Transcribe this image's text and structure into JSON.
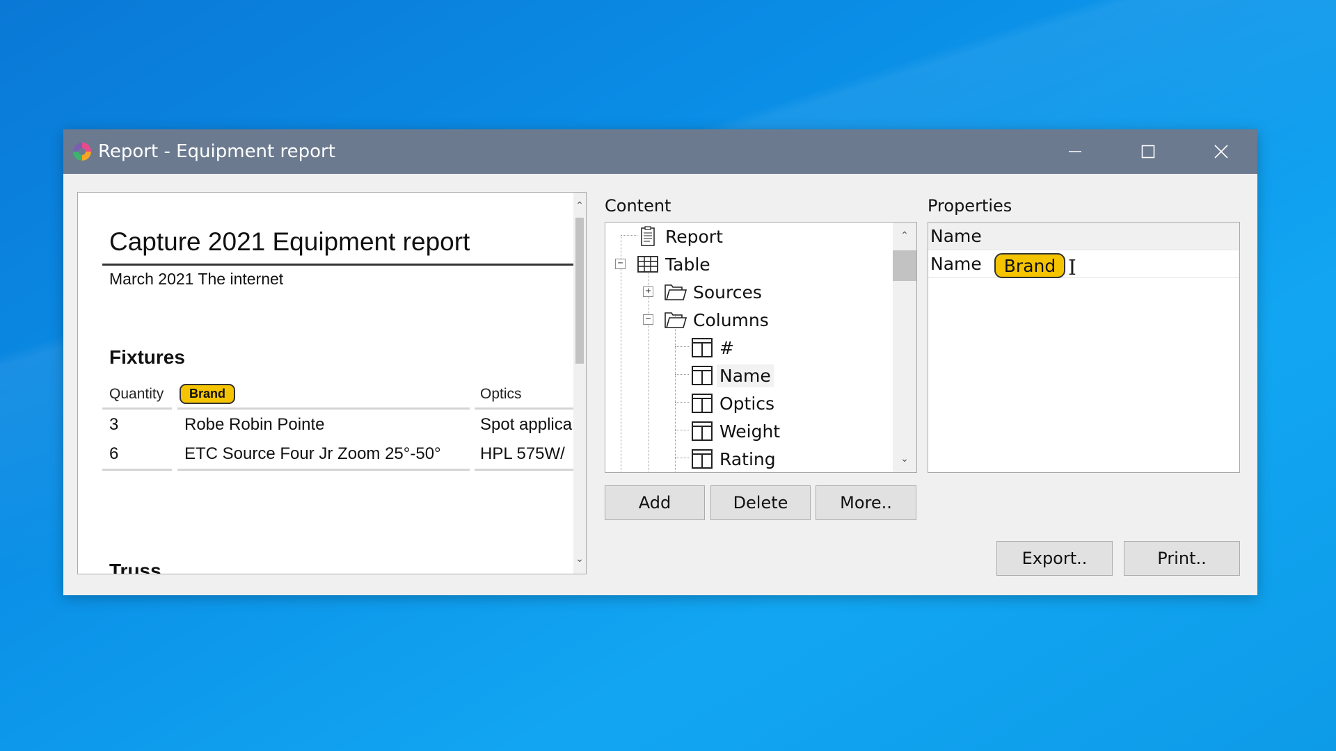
{
  "window": {
    "title": "Report - Equipment report",
    "controls": [
      "minimize",
      "maximize",
      "close"
    ]
  },
  "preview": {
    "title": "Capture 2021 Equipment report",
    "subtitle": "March 2021 The internet",
    "section": "Fixtures",
    "columns": [
      "Quantity",
      "Brand",
      "Optics"
    ],
    "rows": [
      [
        "3",
        "Robe Robin Pointe",
        "Spot applica"
      ],
      [
        "6",
        "ETC Source Four Jr Zoom 25°-50°",
        "HPL 575W/"
      ]
    ],
    "next_section": "Truss"
  },
  "content": {
    "label": "Content",
    "tree": [
      {
        "label": "Report",
        "icon": "report-icon"
      },
      {
        "label": "Table",
        "icon": "table-icon",
        "expanded": true
      },
      {
        "label": "Sources",
        "icon": "folder-icon",
        "expanded": false
      },
      {
        "label": "Columns",
        "icon": "folder-open-icon",
        "expanded": true
      },
      {
        "label": "#",
        "icon": "column-icon"
      },
      {
        "label": "Name",
        "icon": "column-icon",
        "selected": true
      },
      {
        "label": "Optics",
        "icon": "column-icon"
      },
      {
        "label": "Weight",
        "icon": "column-icon"
      },
      {
        "label": "Rating",
        "icon": "column-icon"
      }
    ],
    "buttons": {
      "add": "Add",
      "delete": "Delete",
      "more": "More.."
    }
  },
  "properties": {
    "label": "Properties",
    "header": "Name",
    "row_key": "Name",
    "row_value": "Brand"
  },
  "actions": {
    "export": "Export..",
    "print": "Print.."
  },
  "colors": {
    "titlebar": "#6b7a8f",
    "highlight_chip": "#f5c400",
    "desktop": "#0a8ee6"
  }
}
